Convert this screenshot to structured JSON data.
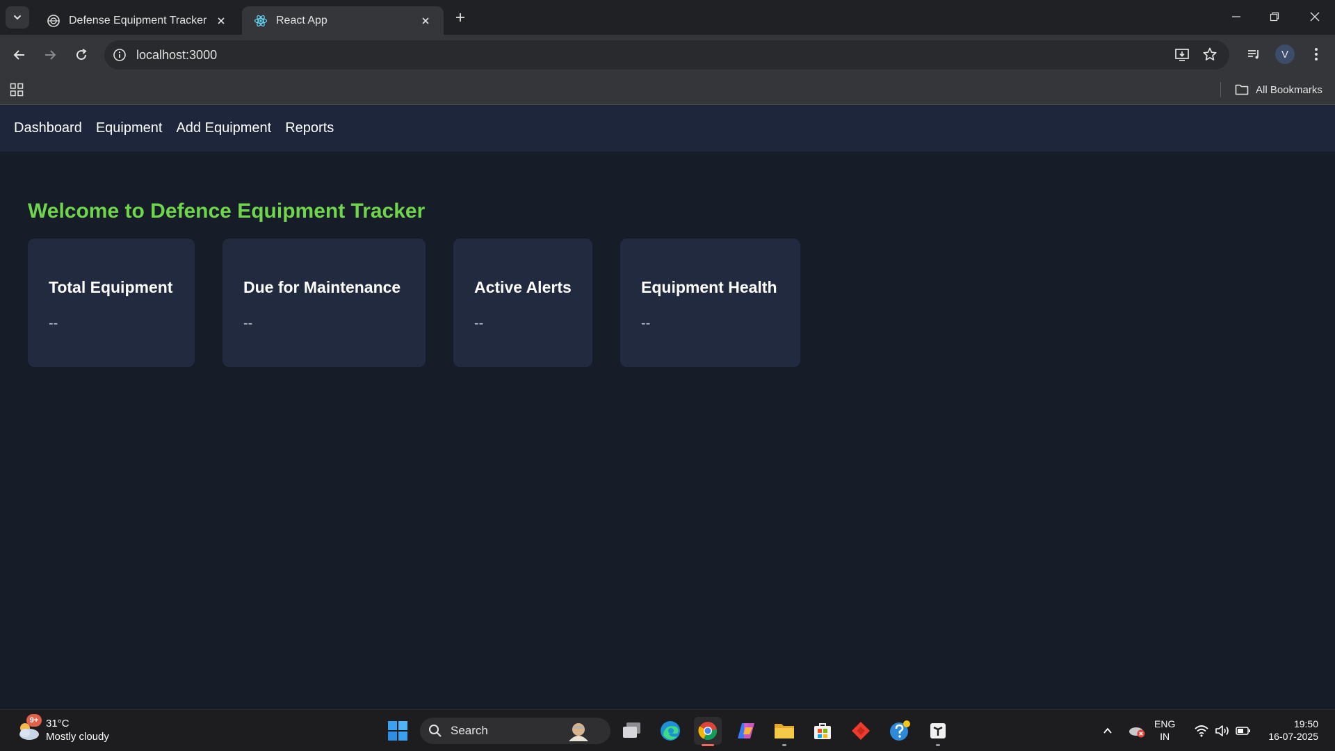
{
  "browser": {
    "tabs": [
      {
        "title": "Defense Equipment Tracker",
        "active": false
      },
      {
        "title": "React App",
        "active": true
      }
    ],
    "url": "localhost:3000",
    "profile_initial": "V",
    "bookmarks_label": "All Bookmarks"
  },
  "app": {
    "nav": [
      "Dashboard",
      "Equipment",
      "Add Equipment",
      "Reports"
    ],
    "welcome": "Welcome to Defence Equipment Tracker",
    "accent_color": "#6fd64c",
    "cards": [
      {
        "title": "Total Equipment",
        "value": "--"
      },
      {
        "title": "Due for Maintenance",
        "value": "--"
      },
      {
        "title": "Active Alerts",
        "value": "--"
      },
      {
        "title": "Equipment Health",
        "value": "--"
      }
    ]
  },
  "taskbar": {
    "weather": {
      "temp": "31°C",
      "condition": "Mostly cloudy",
      "badge": "9+"
    },
    "search_label": "Search",
    "lang": {
      "line1": "ENG",
      "line2": "IN"
    },
    "clock": {
      "time": "19:50",
      "date": "16-07-2025"
    }
  }
}
